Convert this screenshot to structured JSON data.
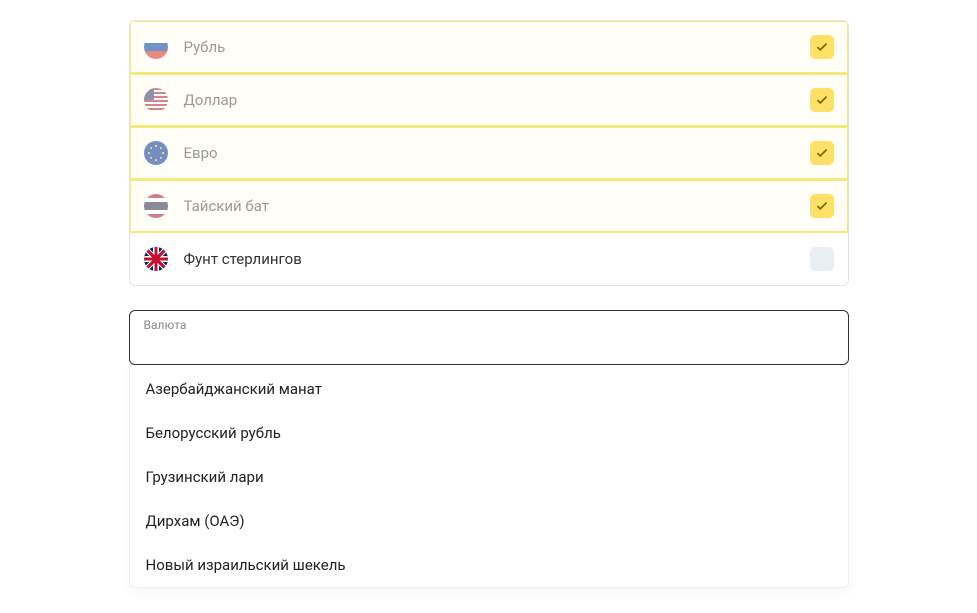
{
  "currencies": [
    {
      "label": "Рубль",
      "flag": "flag-ru",
      "selected": true,
      "name": "currency-row-rub",
      "iconName": "flag-russia-icon"
    },
    {
      "label": "Доллар",
      "flag": "flag-us",
      "selected": true,
      "name": "currency-row-usd",
      "iconName": "flag-usa-icon"
    },
    {
      "label": "Евро",
      "flag": "flag-eu",
      "selected": true,
      "name": "currency-row-eur",
      "iconName": "flag-eu-icon"
    },
    {
      "label": "Тайский бат",
      "flag": "flag-th",
      "selected": true,
      "name": "currency-row-thb",
      "iconName": "flag-thailand-icon"
    },
    {
      "label": "Фунт стерлингов",
      "flag": "flag-gb",
      "selected": false,
      "name": "currency-row-gbp",
      "iconName": "flag-uk-icon"
    }
  ],
  "input": {
    "label": "Валюта",
    "value": ""
  },
  "dropdown": {
    "options": [
      "Азербайджанский манат",
      "Белорусский рубль",
      "Грузинский лари",
      "Дирхам (ОАЭ)",
      "Новый израильский шекель"
    ]
  },
  "colors": {
    "accent": "#ffe066",
    "uncheckedBg": "#e8eef3",
    "selectedBorder": "#f5e97a"
  }
}
